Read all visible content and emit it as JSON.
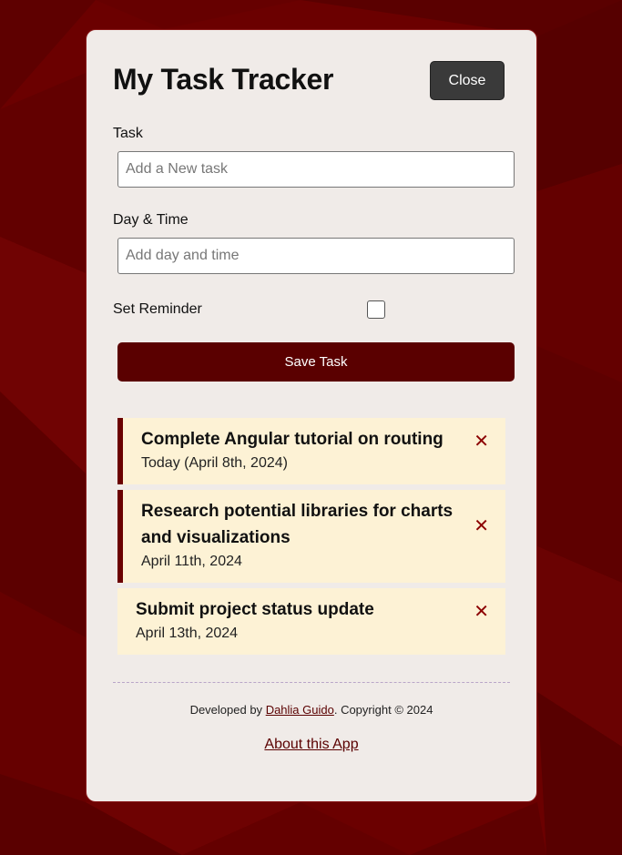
{
  "app": {
    "title": "My Task Tracker",
    "close_label": "Close"
  },
  "form": {
    "task_label": "Task",
    "task_placeholder": "Add a New task",
    "task_value": "",
    "day_label": "Day & Time",
    "day_placeholder": "Add day and time",
    "day_value": "",
    "reminder_label": "Set Reminder",
    "reminder_checked": false,
    "save_label": "Save Task"
  },
  "tasks": [
    {
      "text": "Complete Angular tutorial on routing",
      "day": "Today (April 8th, 2024)",
      "reminder": true,
      "delete_glyph": "✕"
    },
    {
      "text": "Research potential libraries for charts and visualizations",
      "day": "April 11th, 2024",
      "reminder": true,
      "delete_glyph": "✕"
    },
    {
      "text": "Submit project status update",
      "day": "April 13th, 2024",
      "reminder": false,
      "delete_glyph": "✕"
    }
  ],
  "footer": {
    "developed_by": "Developed by ",
    "author": "Dahlia Guido",
    "copyright": ". Copyright © 2024",
    "about_label": "About this App"
  },
  "colors": {
    "background": "#6b0000",
    "card": "#f0ebe8",
    "accent": "#5a0000",
    "task_bg": "#fdf2d5",
    "delete": "#8b0000"
  }
}
